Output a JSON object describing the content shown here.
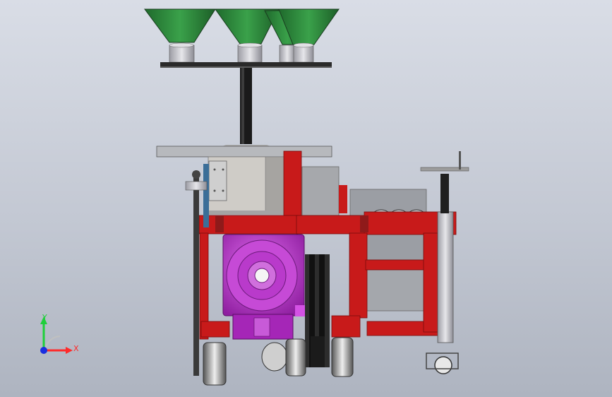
{
  "viewport": {
    "triad": {
      "x_label": "X",
      "y_label": "Y",
      "x_color": "#ff2a2a",
      "y_color": "#1fcf3a",
      "z_color": "#1a2ee0"
    }
  },
  "model": {
    "colors": {
      "hopper": "#2f8a3c",
      "frame": "#c81a1a",
      "rotary_table": "#b32fc3",
      "metal": "#c9c9cc",
      "dark": "#2a2a2a",
      "panel": "#bebcb8"
    }
  }
}
